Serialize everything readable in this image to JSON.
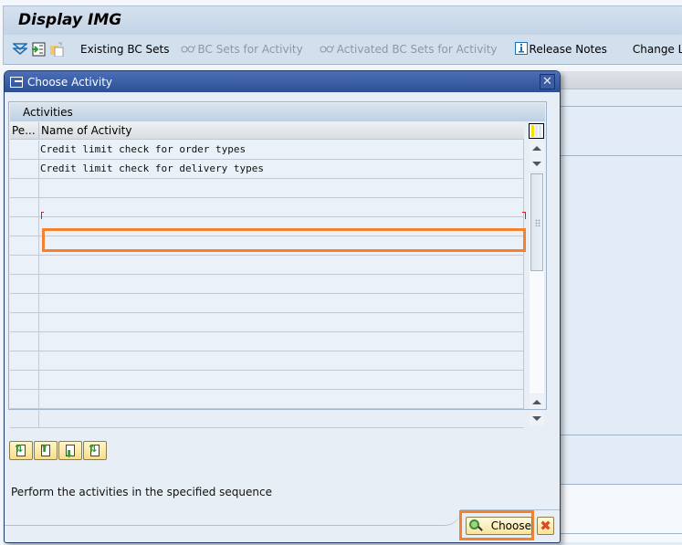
{
  "app": {
    "title": "Display IMG",
    "toolbar": {
      "icons": [
        "expand-all-icon",
        "enter-icon",
        "copy-page-icon"
      ],
      "buttons": [
        {
          "label": "Existing BC Sets",
          "enabled": true,
          "icon": null
        },
        {
          "label": "BC Sets for Activity",
          "enabled": false,
          "icon": "glasses-icon"
        },
        {
          "label": "Activated BC Sets for Activity",
          "enabled": false,
          "icon": "glasses-icon"
        },
        {
          "label": "Release Notes",
          "enabled": true,
          "icon": "info-icon"
        },
        {
          "label": "Change Log",
          "enabled": true,
          "icon": null
        }
      ]
    }
  },
  "dialog": {
    "title": "Choose Activity",
    "close_symbol": "✕",
    "table": {
      "title": "Activities",
      "columns": [
        "Pe...",
        "Name of Activity"
      ],
      "rows": [
        {
          "pe": "",
          "name": "Credit limit check for order types",
          "selected": false
        },
        {
          "pe": "",
          "name": "Credit limit check for delivery types",
          "highlighted": true
        }
      ],
      "empty_row_count": 13
    },
    "move_buttons": [
      "move-to-top",
      "move-up",
      "move-down",
      "move-to-bottom"
    ],
    "hint": "Perform the activities in the specified sequence",
    "choose_label": "Choose",
    "cancel_symbol": "✖"
  },
  "colors": {
    "highlight": "#f5812a",
    "dialog_header": "#2e4f94",
    "button_yellow": "#f8e39a",
    "cancel_red": "#d94a1e"
  }
}
